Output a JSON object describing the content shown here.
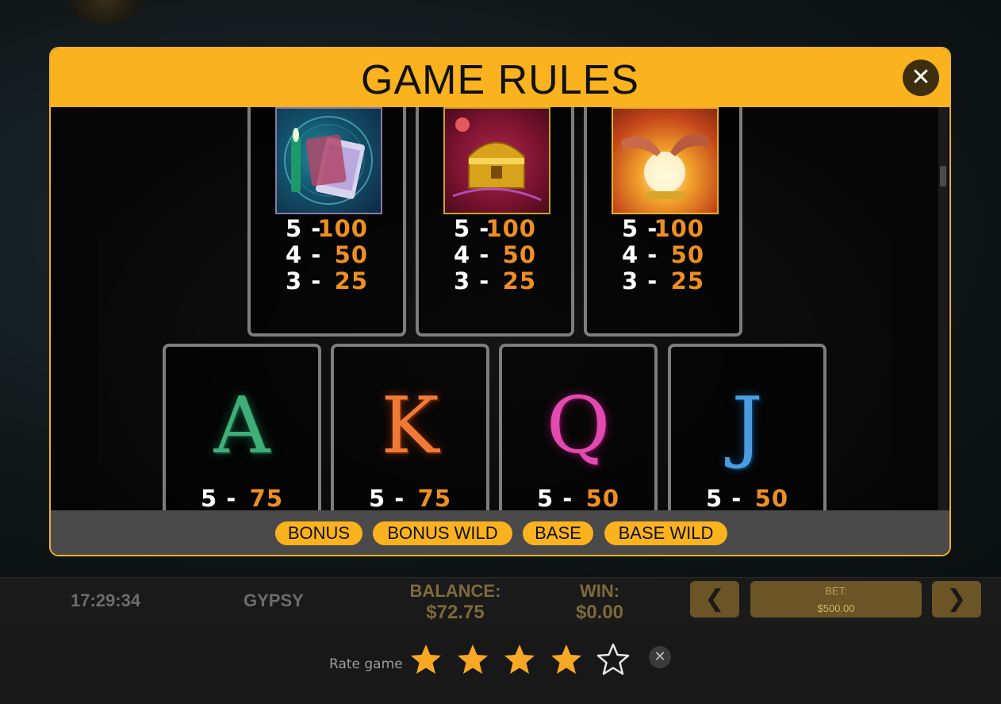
{
  "modal": {
    "title": "GAME RULES",
    "close_icon": "close-icon"
  },
  "symbols_top": [
    {
      "icon": "candle-tarot-cards-symbol-icon",
      "pays": [
        {
          "count": "5 -",
          "value": "100"
        },
        {
          "count": "4 -",
          "value": "50"
        },
        {
          "count": "3 -",
          "value": "25"
        }
      ]
    },
    {
      "icon": "treasure-chest-symbol-icon",
      "pays": [
        {
          "count": "5 -",
          "value": "100"
        },
        {
          "count": "4 -",
          "value": "50"
        },
        {
          "count": "3 -",
          "value": "25"
        }
      ]
    },
    {
      "icon": "crystal-ball-hands-symbol-icon",
      "pays": [
        {
          "count": "5 -",
          "value": "100"
        },
        {
          "count": "4 -",
          "value": "50"
        },
        {
          "count": "3 -",
          "value": "25"
        }
      ]
    }
  ],
  "symbols_bottom": [
    {
      "letter": "A",
      "color": "#2e8f5f",
      "pays": [
        {
          "count": "5 -",
          "value": "75"
        }
      ]
    },
    {
      "letter": "K",
      "color": "#e0662a",
      "pays": [
        {
          "count": "5 -",
          "value": "75"
        }
      ]
    },
    {
      "letter": "Q",
      "color": "#d23ca0",
      "pays": [
        {
          "count": "5 -",
          "value": "50"
        }
      ]
    },
    {
      "letter": "J",
      "color": "#3a8fd0",
      "pays": [
        {
          "count": "5 -",
          "value": "50"
        }
      ]
    }
  ],
  "tabs": [
    "BONUS",
    "BONUS WILD",
    "BASE",
    "BASE WILD"
  ],
  "status": {
    "time": "17:29:34",
    "game_name": "GYPSY",
    "balance_label": "BALANCE:",
    "balance_value": "$72.75",
    "win_label": "WIN:",
    "win_value": "$0.00",
    "bet_label": "BET:",
    "bet_value": "$500.00",
    "prev_arrow": "❮",
    "next_arrow": "❯"
  },
  "rating": {
    "label": "Rate game",
    "stars": 4,
    "max_stars": 5,
    "star_color": "#f9a825",
    "close_glyph": "✕"
  },
  "colors": {
    "accent": "#fbb21f",
    "payout": "#ef8f22"
  }
}
